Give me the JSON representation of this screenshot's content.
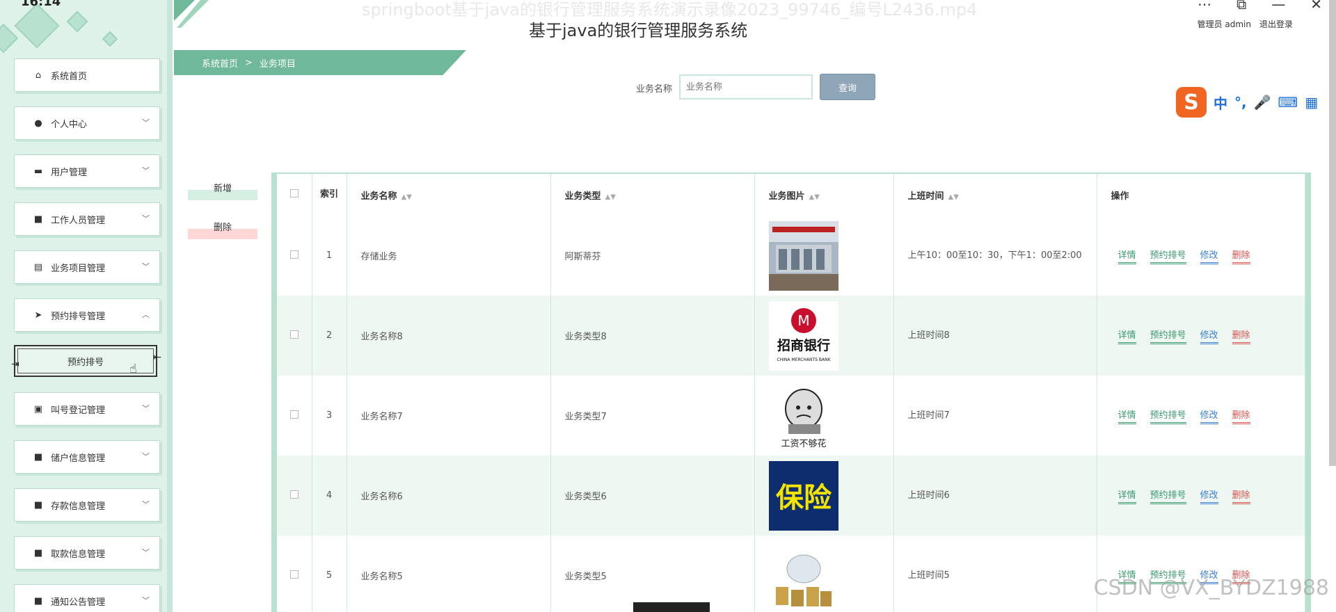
{
  "video": {
    "title": "springboot基于java的银行管理服务系统演示录像2023_99746_编号L2436.mp4",
    "clock": "16:14"
  },
  "header": {
    "title": "基于java的银行管理服务系统",
    "admin_label": "管理员 admin",
    "logout": "退出登录"
  },
  "breadcrumb": {
    "home": "系统首页",
    "separator": ">",
    "current": "业务项目"
  },
  "search": {
    "label": "业务名称",
    "placeholder": "业务名称",
    "button": "查询"
  },
  "actions": {
    "add": "新增",
    "delete": "删除"
  },
  "sidebar": {
    "items": [
      {
        "label": "系统首页",
        "icon": "home-icon",
        "glyph": "⌂",
        "expandable": false
      },
      {
        "label": "个人中心",
        "icon": "user-icon",
        "glyph": "●",
        "expandable": true
      },
      {
        "label": "用户管理",
        "icon": "users-icon",
        "glyph": "▬",
        "expandable": true
      },
      {
        "label": "工作人员管理",
        "icon": "grid-icon",
        "glyph": "■",
        "expandable": true
      },
      {
        "label": "业务项目管理",
        "icon": "document-icon",
        "glyph": "▤",
        "expandable": true
      },
      {
        "label": "预约排号管理",
        "icon": "send-icon",
        "glyph": "➤",
        "expandable": true,
        "expanded": true
      },
      {
        "label": "叫号登记管理",
        "icon": "message-icon",
        "glyph": "▣",
        "expandable": true
      },
      {
        "label": "储户信息管理",
        "icon": "grid-icon",
        "glyph": "■",
        "expandable": true
      },
      {
        "label": "存款信息管理",
        "icon": "grid-icon",
        "glyph": "■",
        "expandable": true
      },
      {
        "label": "取款信息管理",
        "icon": "grid-icon",
        "glyph": "■",
        "expandable": true
      },
      {
        "label": "通知公告管理",
        "icon": "grid-icon",
        "glyph": "■",
        "expandable": true
      }
    ],
    "sub_item": "预约排号"
  },
  "table": {
    "headers": {
      "index": "索引",
      "name": "业务名称",
      "type": "业务类型",
      "image": "业务图片",
      "time": "上班时间",
      "ops": "操作"
    },
    "ops": {
      "detail": "详情",
      "reserve": "预约排号",
      "edit": "修改",
      "delete": "删除"
    },
    "rows": [
      {
        "index": "1",
        "name": "存储业务",
        "type": "阿斯蒂芬",
        "time": "上午10：00至10：30，下午1：00至2:00",
        "image": "bank-building"
      },
      {
        "index": "2",
        "name": "业务名称8",
        "type": "业务类型8",
        "time": "上班时间8",
        "image": "cmb-logo"
      },
      {
        "index": "3",
        "name": "业务名称7",
        "type": "业务类型7",
        "time": "上班时间7",
        "image": "meme-sticker"
      },
      {
        "index": "4",
        "name": "业务名称6",
        "type": "业务类型6",
        "time": "上班时间6",
        "image": "insurance-sign"
      },
      {
        "index": "5",
        "name": "业务名称5",
        "type": "业务类型5",
        "time": "上班时间5",
        "image": "piggy-bank"
      }
    ],
    "image_text": {
      "cmb": "招商银行",
      "cmb_en": "CHINA MERCHANTS BANK",
      "meme": "工资不够花",
      "insurance": "保险"
    }
  },
  "ime": {
    "lang": "中",
    "punct": "°,"
  },
  "watermark": "CSDN @VX_BYDZ1988",
  "colors": {
    "accent": "#6fb89a",
    "sidebar_bg": "#dff2ea",
    "link_green": "#3a9a6e",
    "link_blue": "#3c7fd1",
    "link_red": "#d9534f"
  }
}
